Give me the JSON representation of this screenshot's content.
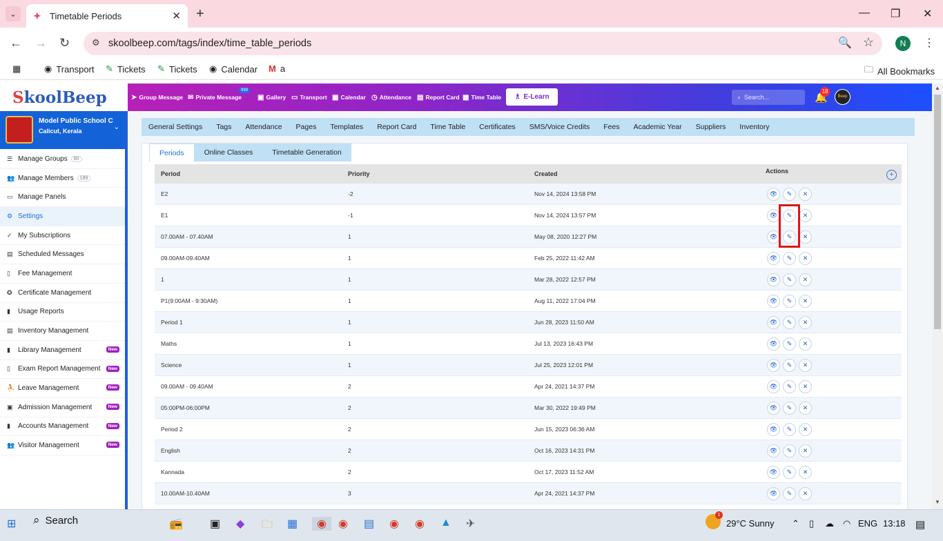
{
  "browser": {
    "tab_title": "Timetable Periods",
    "url": "skoolbeep.com/tags/index/time_table_periods",
    "profile_initial": "N",
    "bookmarks": [
      {
        "label": "Transport",
        "icon": "globe-icon"
      },
      {
        "label": "Tickets",
        "icon": "ticket-icon"
      },
      {
        "label": "Tickets",
        "icon": "ticket-icon"
      },
      {
        "label": "Calendar",
        "icon": "globe-icon"
      },
      {
        "label": "a",
        "icon": "gmail-icon"
      }
    ],
    "all_bookmarks": "All Bookmarks"
  },
  "app": {
    "logo": {
      "s": "S",
      "rest": "koolBeep"
    },
    "nav": [
      {
        "label": "Group Message",
        "icon": "send-icon"
      },
      {
        "label": "Private Message",
        "icon": "mail-icon"
      },
      {
        "label": "Gallery",
        "icon": "image-icon"
      },
      {
        "label": "Transport",
        "icon": "bus-icon"
      },
      {
        "label": "Calendar",
        "icon": "calendar-icon"
      },
      {
        "label": "Attendance",
        "icon": "clock-icon"
      },
      {
        "label": "Report Card",
        "icon": "document-icon"
      },
      {
        "label": "Time Table",
        "icon": "timetable-icon"
      }
    ],
    "private_badge": "999",
    "elearn": "E-Learn",
    "search_placeholder": "Search...",
    "notif_count": "18",
    "avatar_text": "Beep"
  },
  "school": {
    "name": "Model Public School C",
    "location": "Calicut, Kerala"
  },
  "sidebar": [
    {
      "label": "Manage Groups",
      "icon": "list-icon",
      "count": "60"
    },
    {
      "label": "Manage Members",
      "icon": "users-icon",
      "count": "189"
    },
    {
      "label": "Manage Panels",
      "icon": "monitor-icon"
    },
    {
      "label": "Settings",
      "icon": "gear-icon",
      "active": true
    },
    {
      "label": "My Subscriptions",
      "icon": "check-icon"
    },
    {
      "label": "Scheduled Messages",
      "icon": "schedule-icon"
    },
    {
      "label": "Fee Management",
      "icon": "fee-icon"
    },
    {
      "label": "Certificate Management",
      "icon": "certificate-icon"
    },
    {
      "label": "Usage Reports",
      "icon": "bar-chart-icon"
    },
    {
      "label": "Inventory Management",
      "icon": "inventory-icon"
    },
    {
      "label": "Library Management",
      "icon": "book-icon",
      "new": "New"
    },
    {
      "label": "Exam Report Management",
      "icon": "report-icon",
      "new": "New"
    },
    {
      "label": "Leave Management",
      "icon": "leave-icon",
      "new": "New"
    },
    {
      "label": "Admission Management",
      "icon": "admission-icon",
      "new": "New"
    },
    {
      "label": "Accounts Management",
      "icon": "accounts-icon",
      "new": "New"
    },
    {
      "label": "Visitor Management",
      "icon": "visitor-icon",
      "new": "New"
    }
  ],
  "subnav": [
    "General Settings",
    "Tags",
    "Attendance",
    "Pages",
    "Templates",
    "Report Card",
    "Time Table",
    "Certificates",
    "SMS/Voice Credits",
    "Fees",
    "Academic Year",
    "Suppliers",
    "Inventory"
  ],
  "tabs": [
    "Periods",
    "Online Classes",
    "Timetable Generation"
  ],
  "table": {
    "headers": [
      "Period",
      "Priority",
      "Created",
      "Actions"
    ],
    "rows": [
      [
        "E2",
        "-2",
        "Nov 14, 2024 13:58 PM"
      ],
      [
        "E1",
        "-1",
        "Nov 14, 2024 13:57 PM"
      ],
      [
        "07.00AM - 07.40AM",
        "1",
        "May 08, 2020 12:27 PM"
      ],
      [
        "09.00AM-09.40AM",
        "1",
        "Feb 25, 2022 11:42 AM"
      ],
      [
        "1",
        "1",
        "Mar 28, 2022 12:57 PM"
      ],
      [
        "P1(9:00AM - 9:30AM)",
        "1",
        "Aug 11, 2022 17:04 PM"
      ],
      [
        "Period 1",
        "1",
        "Jun 28, 2023 11:50 AM"
      ],
      [
        "Maths",
        "1",
        "Jul 13, 2023 16:43 PM"
      ],
      [
        "Science",
        "1",
        "Jul 25, 2023 12:01 PM"
      ],
      [
        "09.00AM - 09.40AM",
        "2",
        "Apr 24, 2021 14:37 PM"
      ],
      [
        "05:00PM-06:00PM",
        "2",
        "Mar 30, 2022 19:49 PM"
      ],
      [
        "Period 2",
        "2",
        "Jun 15, 2023 06:36 AM"
      ],
      [
        "English",
        "2",
        "Oct 16, 2023 14:31 PM"
      ],
      [
        "Kannada",
        "2",
        "Oct 17, 2023 11:52 AM"
      ],
      [
        "10.00AM-10.40AM",
        "3",
        "Apr 24, 2021 14:37 PM"
      ]
    ]
  },
  "taskbar": {
    "search": "Search",
    "weather_badge": "1",
    "weather": "29°C  Sunny",
    "lang": "ENG",
    "time": "13:18"
  }
}
